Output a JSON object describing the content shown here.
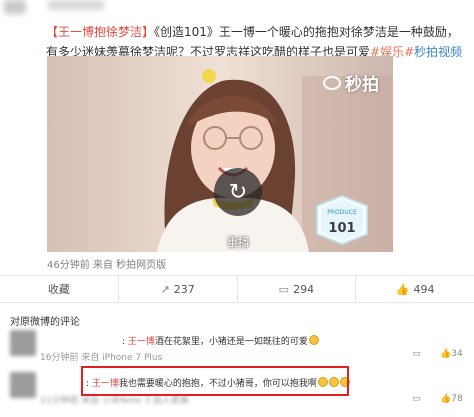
{
  "post": {
    "text_tag": "【王一博抱徐梦洁】",
    "text_main": "《创造101》王一博一个暖心的拖抱对徐梦洁是一种鼓励，有多少迷妹羡慕徐梦洁呢？不过罗志祥这吃醋的样子也是可爱",
    "text_link": "#娱乐#",
    "text_media": "秒拍视频",
    "video": {
      "watermark": "秒拍",
      "replay_label": "重播",
      "badge_text": "PRODUCE 101"
    },
    "meta": "46分钟前 来自 秒拍网页版"
  },
  "actions": [
    {
      "icon": "bookmark-icon",
      "label": "收藏",
      "glyph": ""
    },
    {
      "icon": "share-icon",
      "label": "237",
      "glyph": "↗"
    },
    {
      "icon": "comment-icon",
      "label": "294",
      "glyph": "▭"
    },
    {
      "icon": "like-icon",
      "label": "494",
      "glyph": "👍"
    }
  ],
  "comments_header": "对原微博的评论",
  "comments": [
    {
      "name": "王一博",
      "text": "酒在花絮里，小猪还是一如既往的可爱",
      "emoji_count": 1,
      "time": "16分钟前 来自 iPhone 7 Plus",
      "likes": "34"
    },
    {
      "name": "王一博",
      "text": "我也需要暖心的抱抱，不过小猪哥，你可以抱我啊",
      "emoji_count": 3,
      "time": "21分钟前 来自 小米Note 3 拍人更美",
      "likes": "78"
    }
  ],
  "colors": {
    "accent": "#e8493e",
    "link": "#eb7350",
    "highlight": "#e02020"
  }
}
